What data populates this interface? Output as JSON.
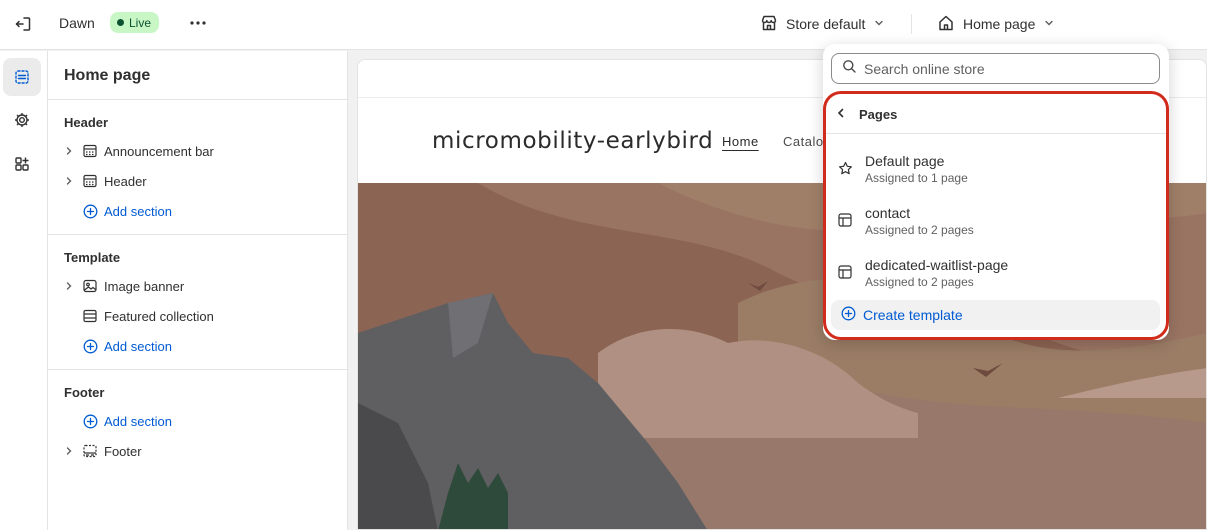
{
  "topbar": {
    "theme_name": "Dawn",
    "status_badge": "Live",
    "store_selector": "Store default",
    "page_selector": "Home page"
  },
  "sidebar": {
    "title": "Home page",
    "groups": [
      {
        "title": "Header",
        "items": [
          "Announcement bar",
          "Header"
        ],
        "add_label": "Add section"
      },
      {
        "title": "Template",
        "items": [
          "Image banner",
          "Featured collection"
        ],
        "add_label": "Add section"
      },
      {
        "title": "Footer",
        "add_label": "Add section",
        "items": [
          "Footer"
        ]
      }
    ]
  },
  "preview": {
    "store_name": "micromobility-earlybird",
    "nav": [
      "Home",
      "Catalo"
    ]
  },
  "popover": {
    "search_placeholder": "Search online store",
    "section_title": "Pages",
    "templates": [
      {
        "name": "Default page",
        "assigned": "Assigned to 1 page",
        "icon": "star-icon"
      },
      {
        "name": "contact",
        "assigned": "Assigned to 2 pages",
        "icon": "template-icon"
      },
      {
        "name": "dedicated-waitlist-page",
        "assigned": "Assigned to 2 pages",
        "icon": "template-icon"
      }
    ],
    "create_label": "Create template"
  },
  "colors": {
    "accent": "#005bd3",
    "live_badge_bg": "#c8f7c5",
    "highlight_outline": "#d12c1b"
  }
}
